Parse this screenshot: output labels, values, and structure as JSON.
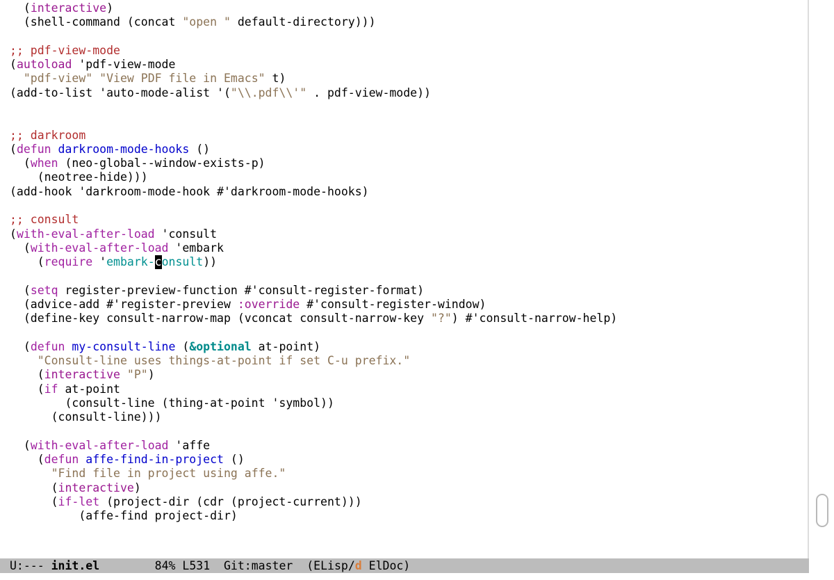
{
  "code": {
    "l01a": "  (",
    "l01b": "interactive",
    "l01c": ")",
    "l02": "  (shell-command (concat ",
    "l02s": "\"open \"",
    "l02b": " default-directory)))",
    "l03": "",
    "l04": ";; pdf-view-mode",
    "l05a": "(",
    "l05b": "autoload",
    "l05c": " 'pdf-view-mode",
    "l06a": "  ",
    "l06s1": "\"pdf-view\"",
    "l06m": " ",
    "l06s2": "\"View PDF file in Emacs\"",
    "l06e": " t)",
    "l07a": "(add-to-list 'auto-mode-alist '(",
    "l07s": "\"\\\\.pdf\\\\'\"",
    "l07b": " . pdf-view-mode))",
    "l08": "",
    "l09": "",
    "l10": ";; darkroom",
    "l11a": "(",
    "l11b": "defun",
    "l11c": " ",
    "l11d": "darkroom-mode-hooks",
    "l11e": " ()",
    "l12a": "  (",
    "l12b": "when",
    "l12c": " (neo-global--window-exists-p)",
    "l13": "    (neotree-hide)))",
    "l14": "(add-hook 'darkroom-mode-hook #'darkroom-mode-hooks)",
    "l15": "",
    "l16": ";; consult",
    "l17a": "(",
    "l17b": "with-eval-after-load",
    "l17c": " 'consult",
    "l18a": "  (",
    "l18b": "with-eval-after-load",
    "l18c": " 'embark",
    "l19a": "    (",
    "l19b": "require",
    "l19c": " '",
    "l19d": "embark-",
    "l19cur": "c",
    "l19e": "onsult",
    "l19f": "))",
    "l20": "",
    "l21a": "  (",
    "l21b": "setq",
    "l21c": " register-preview-function #'consult-register-format)",
    "l22a": "  (advice-add #'register-preview ",
    "l22b": ":override",
    "l22c": " #'consult-register-window)",
    "l23a": "  (define-key consult-narrow-map (vconcat consult-narrow-key ",
    "l23s": "\"?\"",
    "l23b": ") #'consult-narrow-help)",
    "l24": "",
    "l25a": "  (",
    "l25b": "defun",
    "l25c": " ",
    "l25d": "my-consult-line",
    "l25e": " (",
    "l25f": "&optional",
    "l25g": " at-point)",
    "l26a": "    ",
    "l26s": "\"Consult-line uses things-at-point if set C-u prefix.\"",
    "l27a": "    (",
    "l27b": "interactive",
    "l27c": " ",
    "l27s": "\"P\"",
    "l27d": ")",
    "l28a": "    (",
    "l28b": "if",
    "l28c": " at-point",
    "l29": "        (consult-line (thing-at-point 'symbol))",
    "l30": "      (consult-line)))",
    "l31": "",
    "l32a": "  (",
    "l32b": "with-eval-after-load",
    "l32c": " 'affe",
    "l33a": "    (",
    "l33b": "defun",
    "l33c": " ",
    "l33d": "affe-find-in-project",
    "l33e": " ()",
    "l34a": "      ",
    "l34s": "\"Find file in project using affe.\"",
    "l35a": "      (",
    "l35b": "interactive",
    "l35c": ")",
    "l36a": "      (",
    "l36b": "if-let",
    "l36c": " (project-dir (cdr (project-current)))",
    "l37": "          (affe-find project-dir)"
  },
  "modeline": {
    "left": "U:--- ",
    "buffer": "init.el",
    "spacer1": "        ",
    "percent": "84%",
    "line": " L531",
    "git": "  Git:master",
    "mode_open": "  (ELisp",
    "sep": "/",
    "accent": "d",
    "mode_close": " ElDoc)"
  }
}
